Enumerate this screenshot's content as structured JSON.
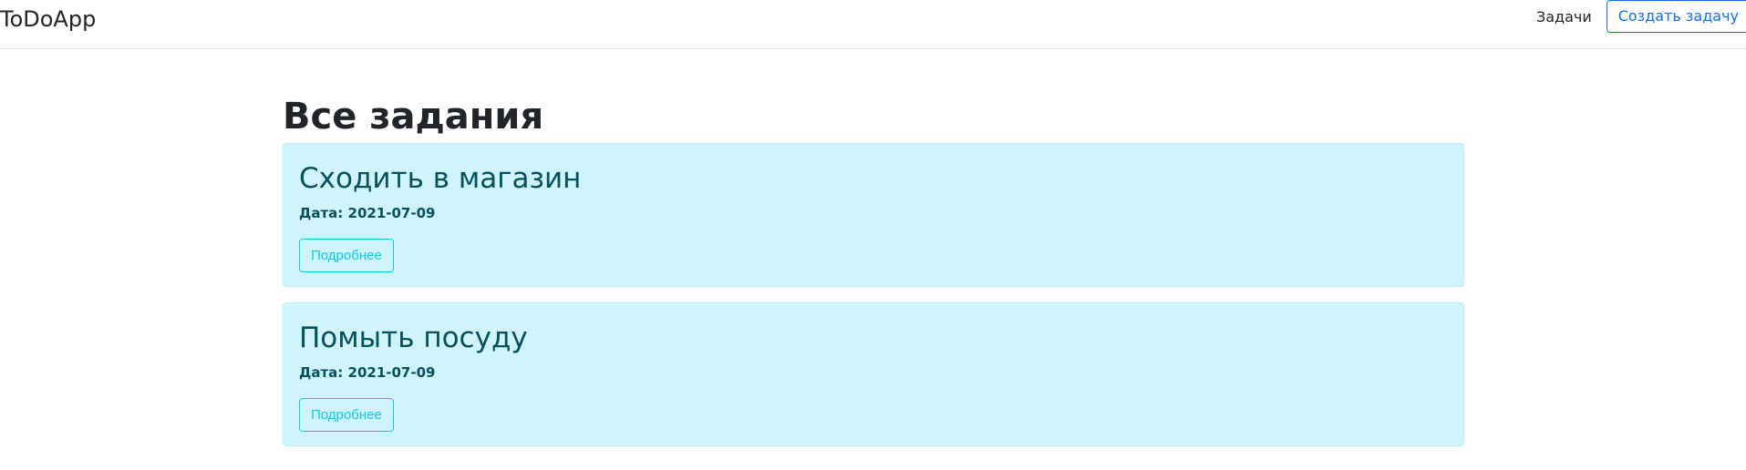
{
  "navbar": {
    "brand": "ToDoApp",
    "links": {
      "tasks": "Задачи",
      "create_task": "Создать задачу"
    }
  },
  "main": {
    "title": "Все задания",
    "tasks": [
      {
        "title": "Сходить в магазин",
        "date_label": "Дата: 2021-07-09",
        "details_label": "Подробнее"
      },
      {
        "title": "Помыть посуду",
        "date_label": "Дата: 2021-07-09",
        "details_label": "Подробнее"
      }
    ]
  },
  "colors": {
    "card_background": "#cff4fc",
    "card_text": "#055160",
    "info_accent": "#0dcaf0",
    "primary_accent": "#0d6efd"
  }
}
